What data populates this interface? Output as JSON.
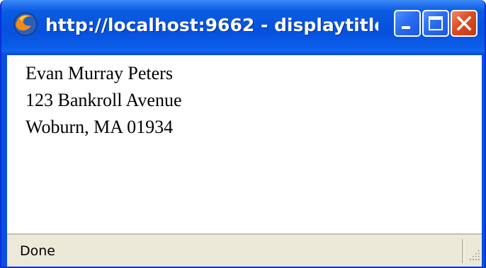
{
  "window": {
    "title": "http://localhost:9662 - displaytitle -...",
    "app_icon": "firefox-icon",
    "controls": {
      "minimize_icon": "minimize-icon",
      "maximize_icon": "maximize-icon",
      "close_icon": "close-icon"
    }
  },
  "content": {
    "address_lines": [
      "Evan Murray Peters",
      "123 Bankroll Avenue",
      "Woburn, MA 01934"
    ]
  },
  "statusbar": {
    "text": "Done",
    "grip_icon": "resize-grip-icon"
  },
  "colors": {
    "titlebar": "#0551dd",
    "close_button": "#dd4b22",
    "statusbar": "#ece9d8"
  }
}
